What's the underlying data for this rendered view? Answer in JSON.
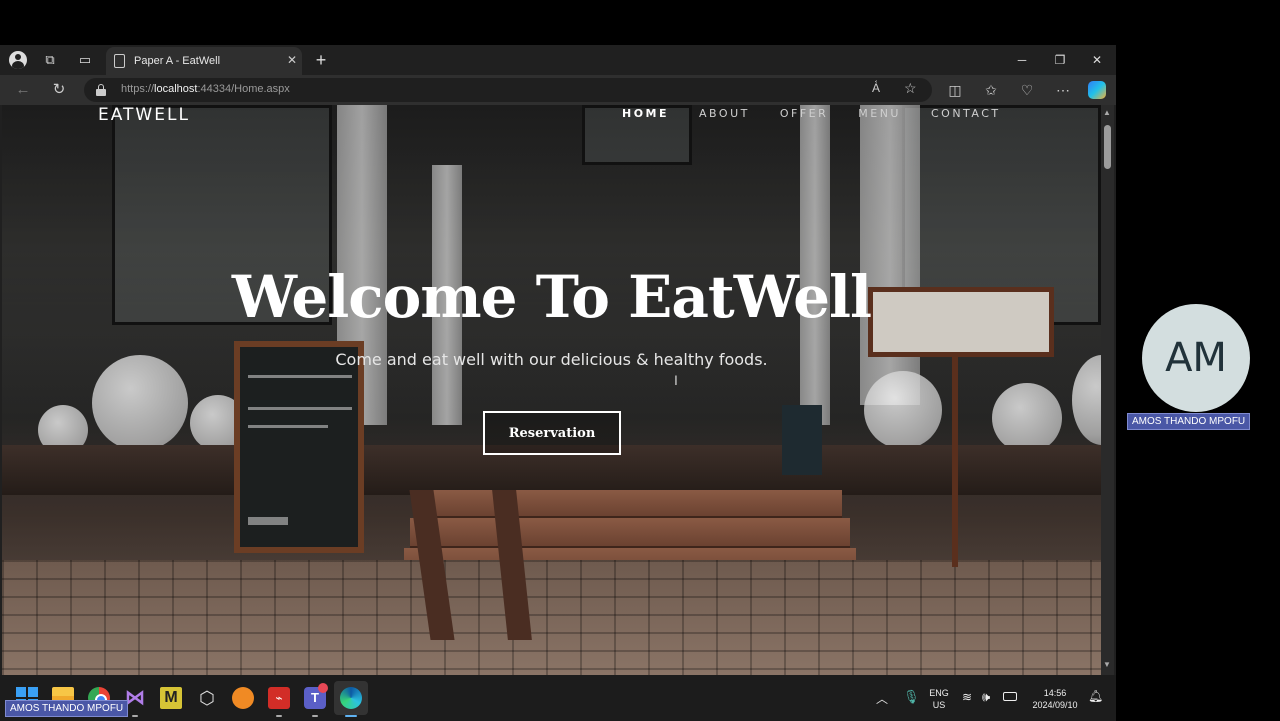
{
  "browser": {
    "tab_title": "Paper A - EatWell",
    "url_prefix": "https://",
    "url_host": "localhost",
    "url_rest": ":44334/Home.aspx"
  },
  "site": {
    "logo": "EATWELL",
    "nav": [
      "HOME",
      "ABOUT",
      "OFFER",
      "MENU",
      "CONTACT"
    ],
    "active_nav": "HOME",
    "hero_title": "Welcome To EatWell",
    "hero_subtitle": "Come and eat well with our delicious & healthy foods.",
    "reservation_label": "Reservation"
  },
  "taskbar": {
    "lang_line1": "ENG",
    "lang_line2": "US",
    "time": "14:56",
    "date": "2024/09/10"
  },
  "meeting": {
    "avatar_initials": "AM",
    "participant_name": "AMOS THANDO MPOFU",
    "presenter_name": "AMOS THANDO MPOFU"
  },
  "colors": {
    "taskbar_bg": "#1c1c1c",
    "browser_bg": "#202020",
    "name_tag_bg": "#4a57a6",
    "avatar_bg": "#d3dedf"
  },
  "icons": [
    "profile-icon",
    "collections-icon",
    "tabs-view-icon",
    "page-icon",
    "close-icon",
    "plus-icon",
    "back-icon",
    "refresh-icon",
    "lock-icon",
    "read-aloud-icon",
    "favorite-star-icon",
    "split-screen-icon",
    "favorites-icon",
    "browser-essentials-icon",
    "more-icon",
    "copilot-icon",
    "windows-start-icon",
    "file-explorer-icon",
    "chrome-icon",
    "visual-studio-icon",
    "wifi-icon",
    "volume-icon",
    "battery-icon",
    "notification-icon"
  ]
}
